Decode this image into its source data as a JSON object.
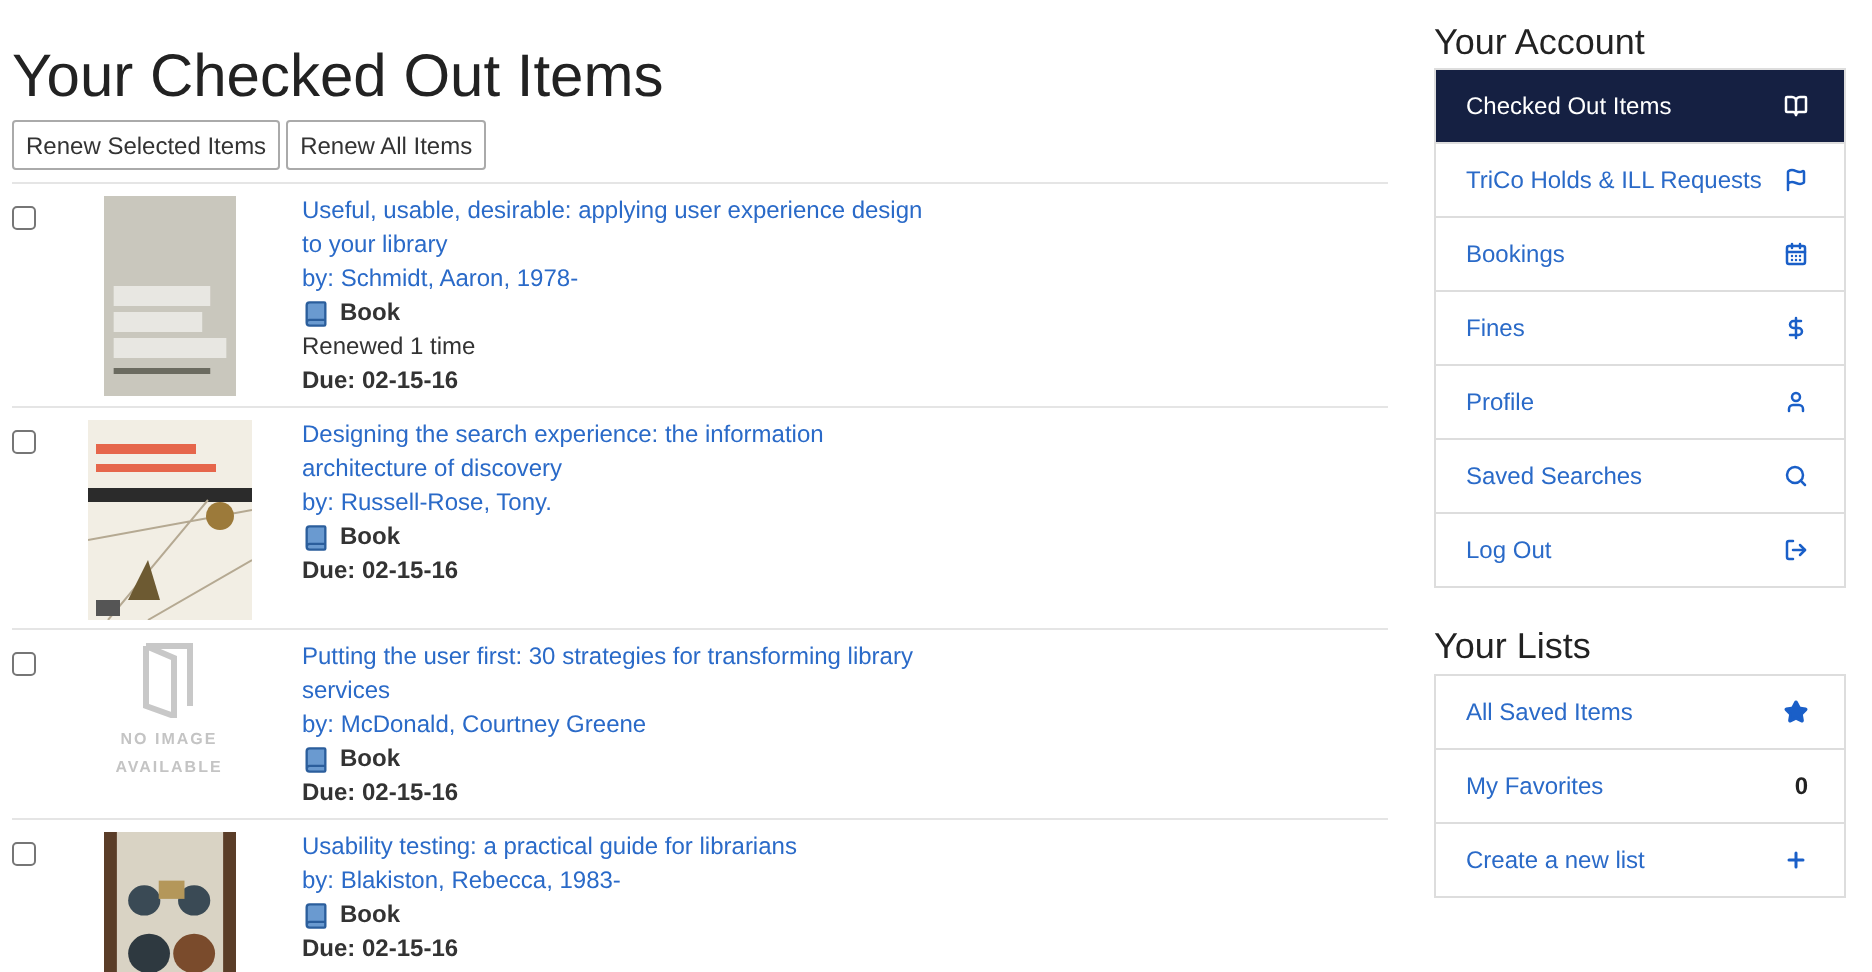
{
  "page_title": "Your Checked Out Items",
  "actions": [
    "Renew Selected Items",
    "Renew All Items"
  ],
  "items": [
    {
      "checked": false,
      "title": "Useful, usable, desirable: applying user experience design to your library",
      "author": "by: Schmidt, Aaron, 1978-",
      "format": "Book",
      "renewed": "Renewed 1 time",
      "due": "Due: 02-15-16"
    },
    {
      "checked": false,
      "title": "Designing the search experience: the information architecture of discovery",
      "author": "by: Russell-Rose, Tony.",
      "format": "Book",
      "due": "Due: 02-15-16"
    },
    {
      "checked": false,
      "cover": {
        "kind": "placeholder",
        "lines": [
          "NO IMAGE",
          "AVAILABLE"
        ]
      },
      "title": "Putting the user first: 30 strategies for transforming library services",
      "author": "by: McDonald, Courtney Greene",
      "format": "Book",
      "due": "Due: 02-15-16"
    },
    {
      "checked": false,
      "title": "Usability testing: a practical guide for librarians",
      "author": "by: Blakiston, Rebecca, 1983-",
      "format": "Book",
      "due": "Due: 02-15-16"
    }
  ],
  "account": {
    "heading": "Your Account",
    "items": [
      {
        "label": "Checked Out Items",
        "selected": true,
        "kind": "icon"
      },
      {
        "label": "TriCo Holds & ILL Requests",
        "selected": false,
        "kind": "icon"
      },
      {
        "label": "Bookings",
        "selected": false,
        "kind": "icon"
      },
      {
        "label": "Fines",
        "selected": false,
        "kind": "icon"
      },
      {
        "label": "Profile",
        "selected": false,
        "kind": "icon"
      },
      {
        "label": "Saved Searches",
        "selected": false,
        "kind": "icon"
      },
      {
        "label": "Log Out",
        "selected": false,
        "kind": "icon"
      }
    ]
  },
  "lists": {
    "heading": "Your Lists",
    "items": [
      {
        "label": "All Saved Items",
        "kind": "icon"
      },
      {
        "label": "My Favorites",
        "kind": "count",
        "count": "0"
      },
      {
        "label": "Create a new list",
        "kind": "icon"
      }
    ]
  }
}
